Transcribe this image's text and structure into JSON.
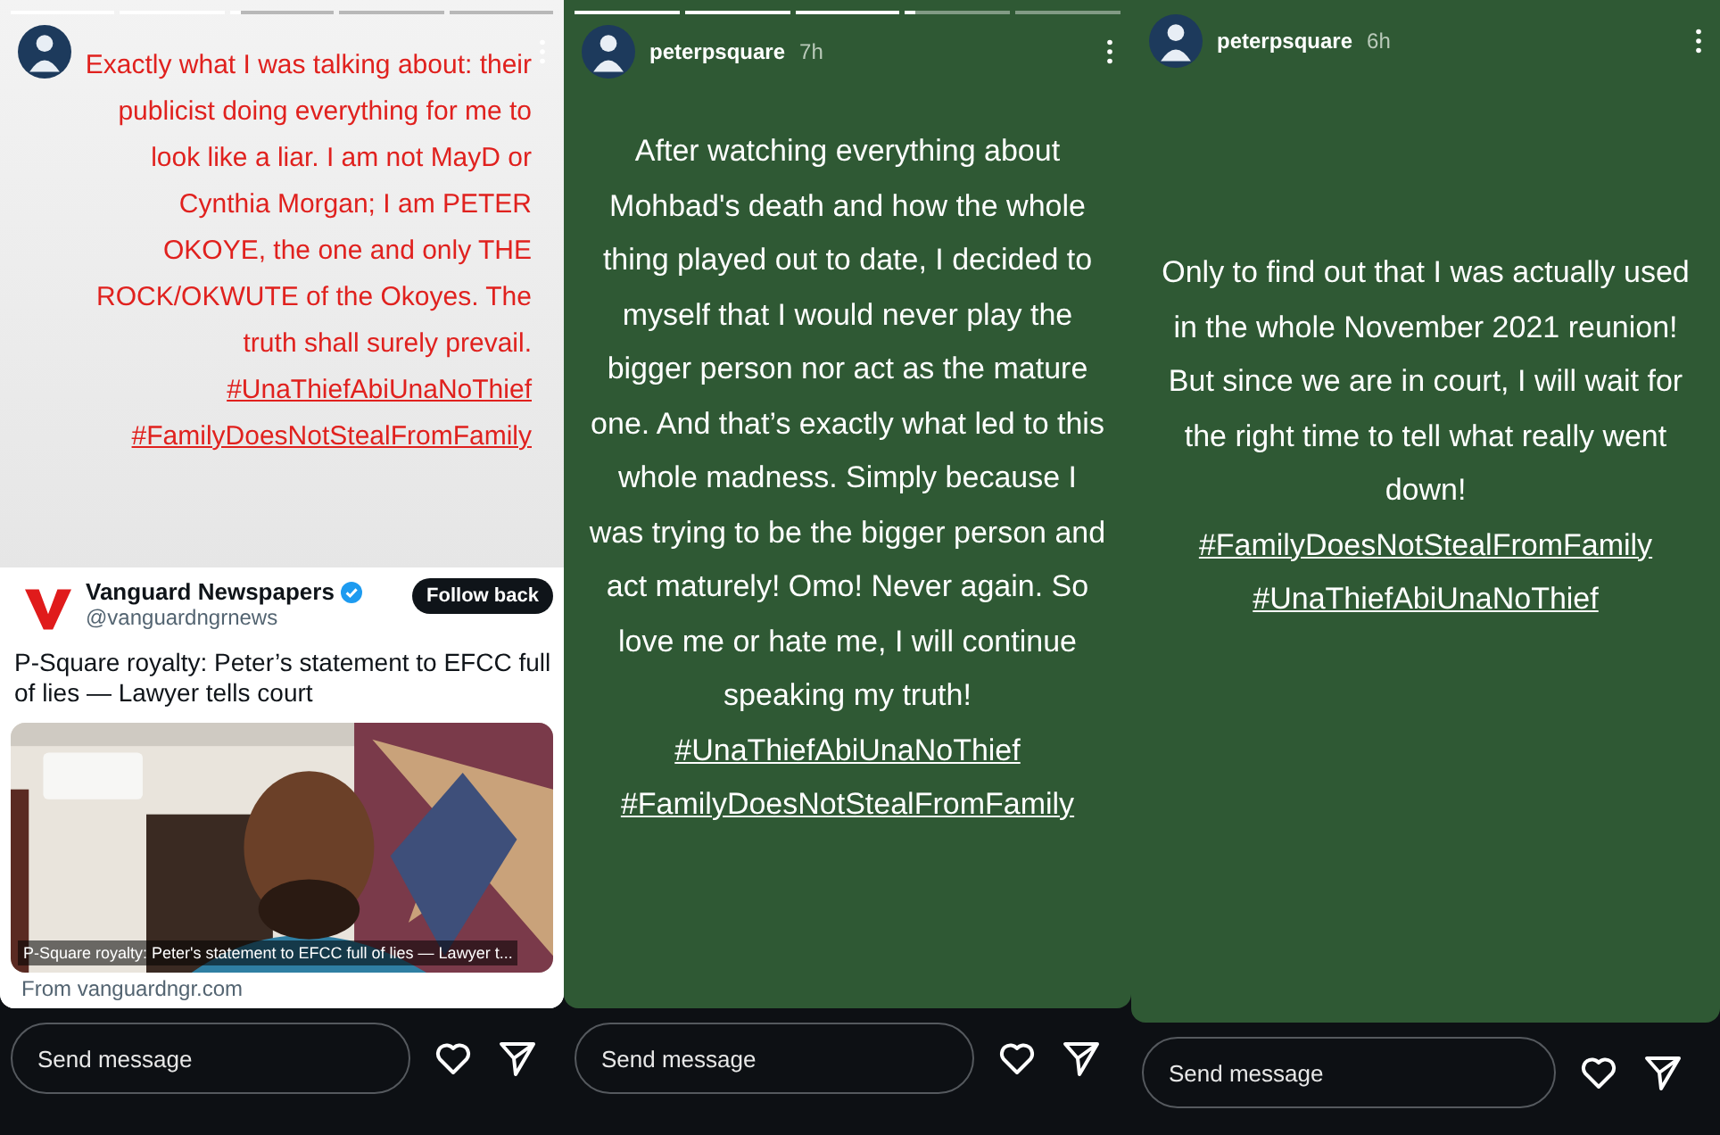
{
  "stories": [
    {
      "kind": "light",
      "progress": [
        {
          "level": 1
        },
        {
          "level": 1
        },
        {
          "level": 0.1
        },
        {
          "level": 0
        },
        {
          "level": 0
        }
      ],
      "paragraphs": [
        {
          "kind": "text",
          "text": "Exactly what I was talking about: their publicist doing everything for me to look like a liar. I am not MayD or Cynthia Morgan; I am PETER OKOYE, the one and only THE ROCK/OKWUTE of the Okoyes. The truth shall surely prevail."
        },
        {
          "kind": "hashtag",
          "text": "#UnaThiefAbiUnaNoThief"
        },
        {
          "kind": "hashtag",
          "text": "#FamilyDoesNotStealFromFamily"
        }
      ],
      "tweet": {
        "name": "Vanguard Newspapers",
        "handle": "@vanguardngrnews",
        "button": "Follow back",
        "headline": "P-Square royalty: Peter’s statement to EFCC full of lies — Lawyer tells court",
        "image_caption": "P-Square royalty: Peter's statement to EFCC full of lies — Lawyer t...",
        "source": "From vanguardngr.com"
      },
      "composer": {
        "placeholder": "Send message"
      }
    },
    {
      "kind": "green",
      "username": "peterpsquare",
      "time": "7h",
      "progress": [
        {
          "level": 1
        },
        {
          "level": 1
        },
        {
          "level": 1
        },
        {
          "level": 0.1
        },
        {
          "level": 0
        }
      ],
      "paragraphs": [
        {
          "kind": "text",
          "text": "After watching everything about Mohbad's death and how the whole thing played out to date, I decided to myself that I would never play the bigger person nor act as the mature one. And that’s exactly what led to this whole madness. Simply because I was trying to be the bigger person and act maturely! Omo! Never again. So love me or hate me, I will continue speaking my truth!"
        },
        {
          "kind": "hashtag",
          "text": "#UnaThiefAbiUnaNoThief"
        },
        {
          "kind": "hashtag",
          "text": "#FamilyDoesNotStealFromFamily"
        }
      ],
      "composer": {
        "placeholder": "Send message"
      }
    },
    {
      "kind": "green",
      "username": "peterpsquare",
      "time": "6h",
      "paragraphs": [
        {
          "kind": "text",
          "text": "Only to find out that I was actually used in the whole November 2021 reunion! But since we are in court, I will wait for the right time to tell what really went down!"
        },
        {
          "kind": "hashtag",
          "text": "#FamilyDoesNotStealFromFamily"
        },
        {
          "kind": "hashtag",
          "text": "#UnaThiefAbiUnaNoThief"
        }
      ],
      "composer": {
        "placeholder": "Send message"
      }
    }
  ]
}
